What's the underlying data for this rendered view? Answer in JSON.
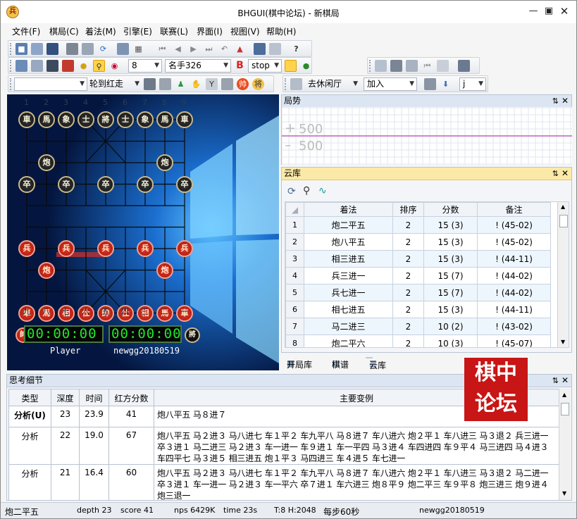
{
  "window": {
    "title": "BHGUI(棋中论坛) - 新棋局",
    "icon_text": "兵"
  },
  "menu": [
    "文件(F)",
    "棋局(C)",
    "着法(M)",
    "引擎(E)",
    "联赛(L)",
    "界面(I)",
    "视图(V)",
    "帮助(H)"
  ],
  "toolbar2": {
    "depth_value": "8",
    "engine_name": "名手326",
    "stop_label": "stop",
    "b_label": "B"
  },
  "toolbar3": {
    "side_value": "轮到红走",
    "opponent_value": "去休闲厅",
    "join_value": "加入",
    "j_value": "j"
  },
  "board": {
    "file_numbers_top": [
      "1",
      "2",
      "3",
      "4",
      "5",
      "6",
      "7",
      "8",
      "9"
    ],
    "file_numbers_bottom": [
      "九",
      "八",
      "七",
      "六",
      "五",
      "四",
      "三",
      "二",
      "一"
    ],
    "pieces_black": [
      {
        "t": "車",
        "c": 0,
        "r": 0
      },
      {
        "t": "馬",
        "c": 1,
        "r": 0
      },
      {
        "t": "象",
        "c": 2,
        "r": 0
      },
      {
        "t": "士",
        "c": 3,
        "r": 0
      },
      {
        "t": "將",
        "c": 4,
        "r": 0
      },
      {
        "t": "士",
        "c": 5,
        "r": 0
      },
      {
        "t": "象",
        "c": 6,
        "r": 0
      },
      {
        "t": "馬",
        "c": 7,
        "r": 0
      },
      {
        "t": "車",
        "c": 8,
        "r": 0
      },
      {
        "t": "炮",
        "c": 1,
        "r": 2
      },
      {
        "t": "炮",
        "c": 7,
        "r": 2
      },
      {
        "t": "卒",
        "c": 0,
        "r": 3
      },
      {
        "t": "卒",
        "c": 2,
        "r": 3
      },
      {
        "t": "卒",
        "c": 4,
        "r": 3
      },
      {
        "t": "卒",
        "c": 6,
        "r": 3
      },
      {
        "t": "卒",
        "c": 8,
        "r": 3
      }
    ],
    "pieces_red": [
      {
        "t": "兵",
        "c": 0,
        "r": 6
      },
      {
        "t": "兵",
        "c": 2,
        "r": 6
      },
      {
        "t": "兵",
        "c": 4,
        "r": 6
      },
      {
        "t": "兵",
        "c": 6,
        "r": 6
      },
      {
        "t": "兵",
        "c": 8,
        "r": 6
      },
      {
        "t": "炮",
        "c": 1,
        "r": 7
      },
      {
        "t": "炮",
        "c": 7,
        "r": 7
      },
      {
        "t": "車",
        "c": 0,
        "r": 9
      },
      {
        "t": "馬",
        "c": 1,
        "r": 9
      },
      {
        "t": "相",
        "c": 2,
        "r": 9
      },
      {
        "t": "仕",
        "c": 3,
        "r": 9
      },
      {
        "t": "帥",
        "c": 4,
        "r": 9
      },
      {
        "t": "仕",
        "c": 5,
        "r": 9
      },
      {
        "t": "相",
        "c": 6,
        "r": 9
      },
      {
        "t": "馬",
        "c": 7,
        "r": 9
      },
      {
        "t": "車",
        "c": 8,
        "r": 9
      }
    ],
    "red_badge": "帥",
    "black_badge": "將",
    "red_clock": "00:00:00",
    "black_clock": "00:00:00",
    "red_player": "Player",
    "black_player": "newgg20180519"
  },
  "trend_panel": {
    "title": "局势",
    "ticks": [
      "500",
      "500"
    ],
    "line_color": "#c060c0"
  },
  "cloud_panel": {
    "title": "云库",
    "columns": [
      "着法",
      "排序",
      "分数",
      "备注"
    ],
    "rows": [
      {
        "n": "1",
        "move": "炮二平五",
        "rank": "2",
        "score": "15 (3)",
        "note": "! (45-02)"
      },
      {
        "n": "2",
        "move": "炮八平五",
        "rank": "2",
        "score": "15 (3)",
        "note": "! (45-02)"
      },
      {
        "n": "3",
        "move": "相三进五",
        "rank": "2",
        "score": "15 (3)",
        "note": "! (44-11)"
      },
      {
        "n": "4",
        "move": "兵三进一",
        "rank": "2",
        "score": "15 (7)",
        "note": "! (44-02)"
      },
      {
        "n": "5",
        "move": "兵七进一",
        "rank": "2",
        "score": "15 (7)",
        "note": "! (44-02)"
      },
      {
        "n": "6",
        "move": "相七进五",
        "rank": "2",
        "score": "15 (3)",
        "note": "! (44-11)"
      },
      {
        "n": "7",
        "move": "马二进三",
        "rank": "2",
        "score": "10 (2)",
        "note": "! (43-02)"
      },
      {
        "n": "8",
        "move": "炮二平六",
        "rank": "2",
        "score": "10 (3)",
        "note": "! (45-07)"
      }
    ]
  },
  "tabs": [
    "开局库",
    "棋谱",
    "云库"
  ],
  "thinking_panel": {
    "title": "思考细节",
    "columns": [
      "类型",
      "深度",
      "时间",
      "红方分数",
      "主要变例"
    ],
    "rows": [
      {
        "type": "分析(U)",
        "depth": "23",
        "time": "23.9",
        "score": "41",
        "pv": "炮八平五 马８进７"
      },
      {
        "type": "分析",
        "depth": "22",
        "time": "19.0",
        "score": "67",
        "pv": "炮八平五 马２进３ 马八进七 车１平２ 车九平八 马８进７ 车八进六 炮２平１ 车八进三 马３退２ 兵三进一 卒３进１ 马二进三 马２进３ 车一进一 车９进１ 车一平四 马３进４ 车四进四 车９平４ 马三进四 马４进３ 车四平七 马３进５ 相三进五 炮１平３ 马四进三 车４进５ 车七进一"
      },
      {
        "type": "分析",
        "depth": "21",
        "time": "16.4",
        "score": "60",
        "pv": "炮八平五 马２进３ 马八进七 车１平２ 车九平八 马８进７ 车八进六 炮２平１ 车八进三 马３退２ 马二进一 卒３进１ 车一进一 马２进３ 车一平六 卒７进１ 车六进三 炮８平９ 炮二平三 车９平８ 炮三进三 炮９进４ 炮三退一"
      }
    ]
  },
  "status_bar": {
    "move": "炮二平五",
    "depth": "depth 23",
    "score": "score 41",
    "nps": "nps 6429K",
    "time": "time 23s",
    "hash": "T:8 H:2048",
    "per_move": "每步60秒",
    "player": "newgg20180519"
  },
  "stamp": {
    "text": [
      "棋",
      "中",
      "论",
      "坛"
    ]
  }
}
